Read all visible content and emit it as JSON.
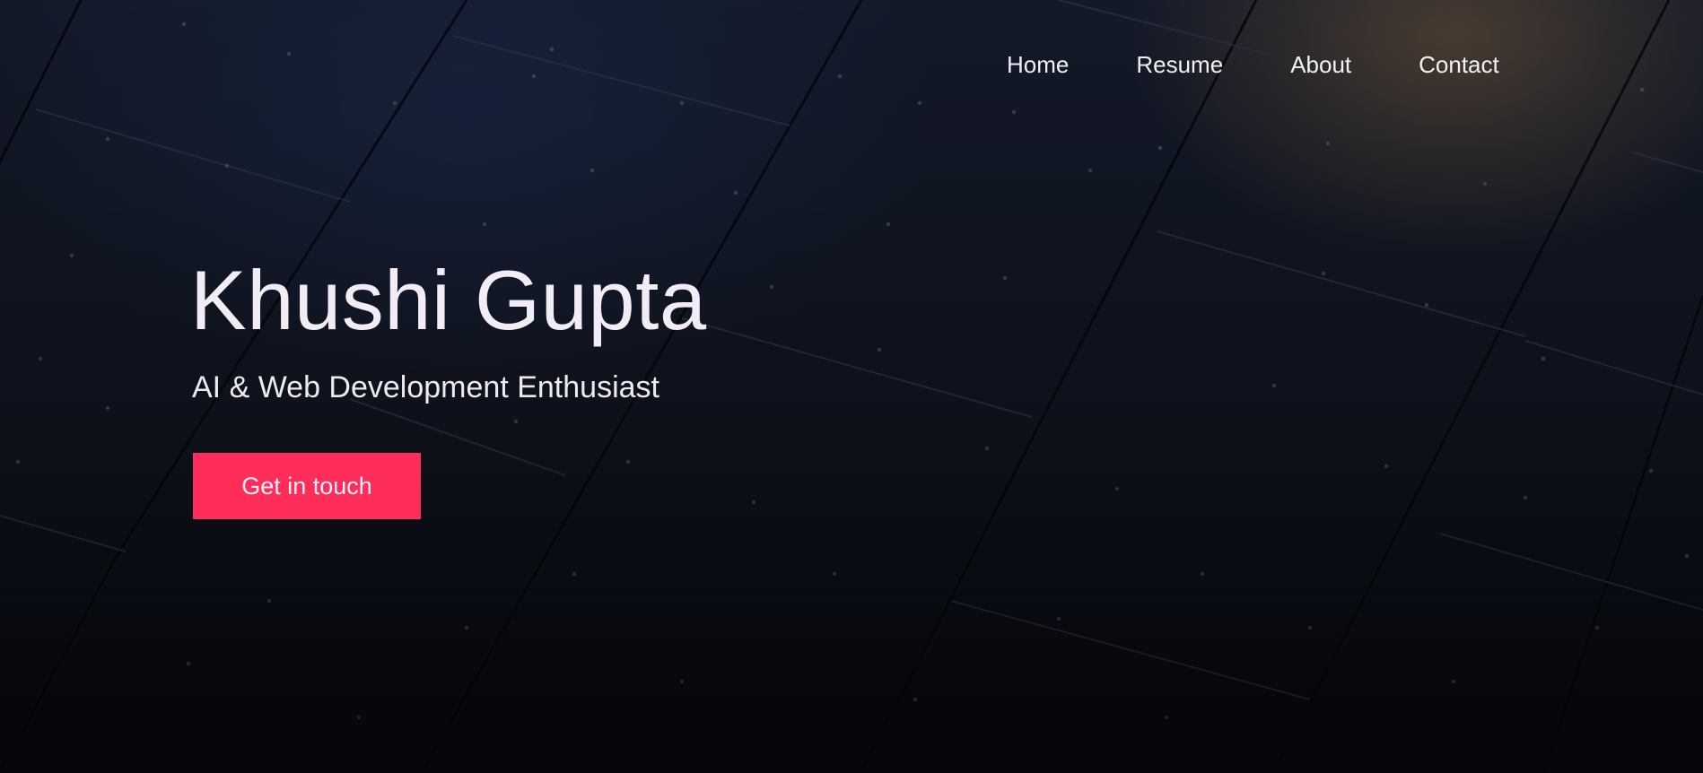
{
  "nav": {
    "items": [
      {
        "label": "Home"
      },
      {
        "label": "Resume"
      },
      {
        "label": "About"
      },
      {
        "label": "Contact"
      }
    ]
  },
  "hero": {
    "name": "Khushi Gupta",
    "tagline": "AI & Web Development Enthusiast",
    "cta_label": "Get in touch",
    "cta_color": "#ff2d5a"
  },
  "background": {
    "description_icon": "metal-panel-background",
    "base_color": "#0b0f1c"
  }
}
